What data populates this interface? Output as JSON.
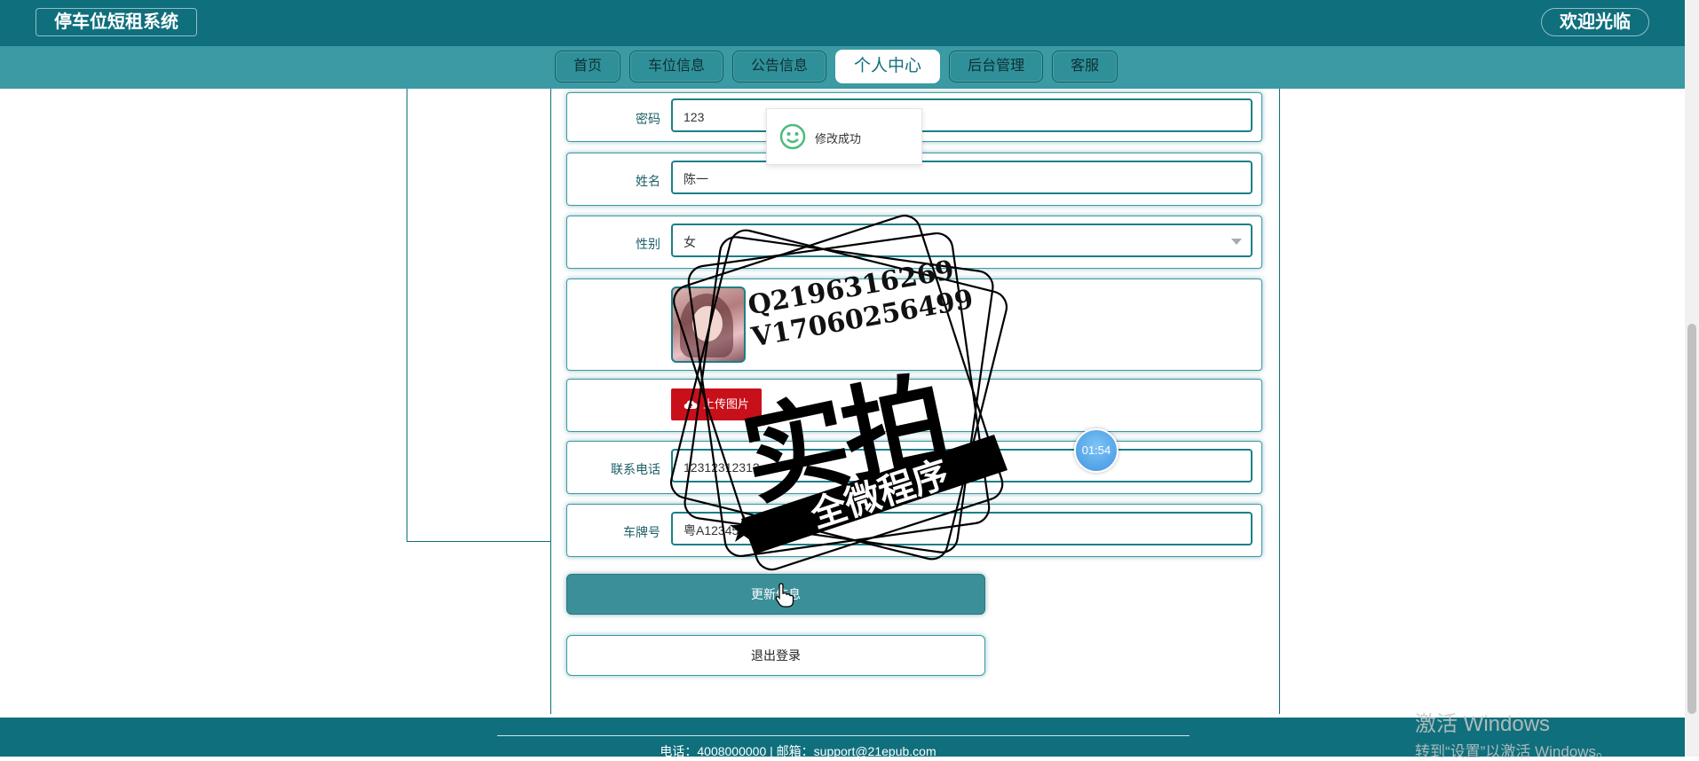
{
  "header": {
    "site_title": "停车位短租系统",
    "welcome": "欢迎光临"
  },
  "nav": {
    "items": [
      {
        "label": "首页"
      },
      {
        "label": "车位信息"
      },
      {
        "label": "公告信息"
      },
      {
        "label": "个人中心",
        "active": true
      },
      {
        "label": "后台管理"
      },
      {
        "label": "客服"
      }
    ]
  },
  "form": {
    "password": {
      "label": "密码",
      "value": "123"
    },
    "name": {
      "label": "姓名",
      "value": "陈一"
    },
    "gender": {
      "label": "性别",
      "value": "女"
    },
    "upload_label": "上传图片",
    "phone": {
      "label": "联系电话",
      "value": "12312312312"
    },
    "plate": {
      "label": "车牌号",
      "value": "粤A12345"
    }
  },
  "buttons": {
    "update": "更新信息",
    "logout": "退出登录"
  },
  "toast": {
    "message": "修改成功",
    "icon": "smile-icon"
  },
  "watermark": {
    "line1": "Q2196316269",
    "line2": "V17060256499",
    "big": "实拍",
    "banner": "全微程序"
  },
  "timer": "01:54",
  "footer": {
    "text": "电话：4008000000 | 邮箱：support@21epub.com"
  },
  "windows_activation": {
    "line1": "激活 Windows",
    "line2": "转到“设置”以激活 Windows。"
  },
  "colors": {
    "primary": "#0f6f7c",
    "nav_bar": "#3b9aa3",
    "upload_button": "#c8101a",
    "update_button": "#3b8f98"
  }
}
